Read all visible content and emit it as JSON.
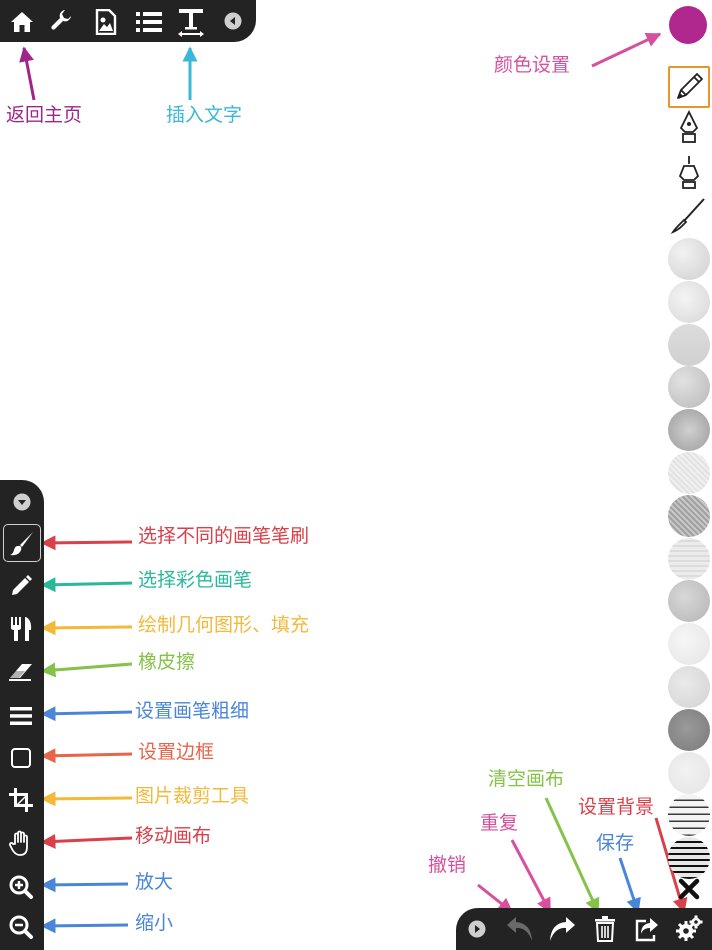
{
  "colors": {
    "toolbar": "#232323",
    "selected_color": "#b0288e",
    "selected_border": "#e8962a",
    "annot_magenta": "#a0258a",
    "annot_cyan": "#3bb8d8",
    "annot_pink": "#d6509e",
    "annot_red": "#d8404a",
    "annot_teal": "#2ab89a",
    "annot_yellow": "#f2b93a",
    "annot_green": "#86c24a",
    "annot_blue": "#4a86d8",
    "annot_orange": "#e8644a"
  },
  "top_toolbar": {
    "icons": [
      "home-icon",
      "wrench-icon",
      "insert-image-icon",
      "list-icon",
      "text-icon",
      "collapse-left-icon"
    ]
  },
  "left_toolbar": {
    "icons": [
      "collapse-down-icon",
      "brush-icon",
      "pencil-icon",
      "fork-knife-icon",
      "eraser-icon",
      "menu-lines-icon",
      "square-icon",
      "crop-icon",
      "hand-icon",
      "zoom-in-icon",
      "zoom-out-icon"
    ]
  },
  "bottom_toolbar": {
    "icons": [
      "expand-right-icon",
      "undo-icon",
      "redo-icon",
      "trash-icon",
      "share-icon",
      "settings-icon"
    ]
  },
  "right_palette": {
    "brushes": [
      "pencil-icon",
      "fountain-pen-icon",
      "ink-pen-icon",
      "paint-brush-icon"
    ],
    "texture_count": 15,
    "close_icon": "close-icon"
  },
  "annotations": {
    "home": "返回主页",
    "insert_text": "插入文字",
    "color_setting": "颜色设置",
    "brush_select": "选择不同的画笔笔刷",
    "color_pen": "选择彩色画笔",
    "shapes": "绘制几何图形、填充",
    "eraser": "橡皮擦",
    "thickness": "设置画笔粗细",
    "border": "设置边框",
    "crop": "图片裁剪工具",
    "move_canvas": "移动画布",
    "zoom_in": "放大",
    "zoom_out": "缩小",
    "undo": "撤销",
    "redo": "重复",
    "clear_canvas": "清空画布",
    "save": "保存",
    "background": "设置背景"
  }
}
